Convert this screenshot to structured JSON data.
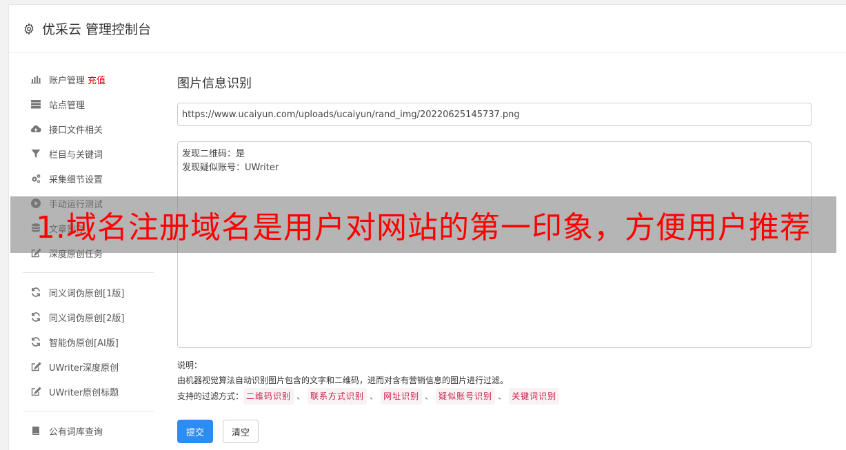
{
  "header": {
    "title": "优采云 管理控制台",
    "icon": "gear-icon"
  },
  "sidebar": {
    "groups": [
      [
        {
          "label": "账户管理",
          "tag": "充值",
          "icon": "bar-chart-icon"
        },
        {
          "label": "站点管理",
          "icon": "server-icon"
        },
        {
          "label": "接口文件相关",
          "icon": "cloud-upload-icon"
        },
        {
          "label": "栏目与关键词",
          "icon": "filter-icon"
        },
        {
          "label": "采集细节设置",
          "icon": "cogs-icon"
        },
        {
          "label": "手动运行测试",
          "icon": "play-circle-icon"
        },
        {
          "label": "文章暂存",
          "icon": "database-icon"
        },
        {
          "label": "深度原创任务",
          "icon": "edit-icon"
        }
      ],
      [
        {
          "label": "同义词伪原创[1版]",
          "icon": "refresh-icon"
        },
        {
          "label": "同义词伪原创[2版]",
          "icon": "refresh-icon"
        },
        {
          "label": "智能伪原创[AI版]",
          "icon": "refresh-icon"
        },
        {
          "label": "UWriter深度原创",
          "icon": "edit-icon"
        },
        {
          "label": "UWriter原创标题",
          "icon": "edit-icon"
        }
      ],
      [
        {
          "label": "公有词库查询",
          "icon": "book-icon"
        }
      ]
    ]
  },
  "main": {
    "title": "图片信息识别",
    "url_value": "https://www.ucaiyun.com/uploads/ucaiyun/rand_img/20220625145737.png",
    "result_text": "发现二维码：是\n发现疑似账号：UWriter",
    "desc_heading": "说明：",
    "desc_line": "由机器视觉算法自动识别图片包含的文字和二维码，进而对含有营销信息的图片进行过滤。",
    "filters_label": "支持的过滤方式：",
    "filters": [
      "二维码识别",
      "联系方式识别",
      "网址识别",
      "疑似账号识别",
      "关键词识别"
    ],
    "separator": "、",
    "submit_label": "提交",
    "clear_label": "清空"
  },
  "overlay": {
    "text": "1.域名注册域名是用户对网站的第一印象，方便用户推荐"
  },
  "colors": {
    "primary": "#2d8cf0",
    "tag_red": "#c7254e",
    "overlay_text": "#ff0000"
  }
}
